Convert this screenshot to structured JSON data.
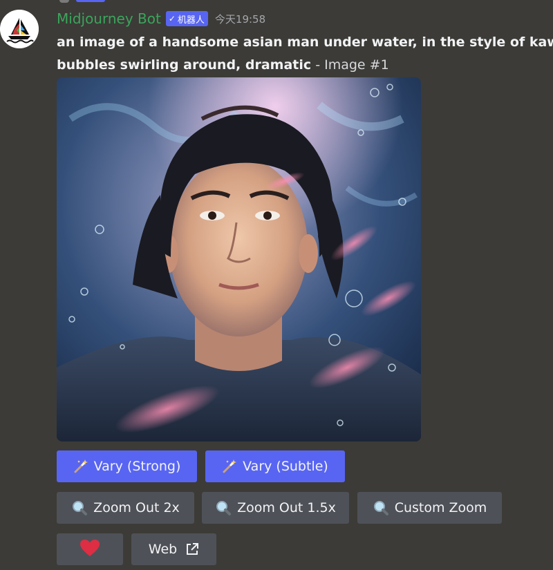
{
  "message": {
    "username": "Midjourney Bot",
    "bot_tag": "机器人",
    "bot_tag_check": "✓",
    "timestamp": "今天19:58",
    "prompt_line1": "an image of a handsome asian man under water, in the style of kawa",
    "prompt_line2_bold": "bubbles swirling around, dramatic",
    "prompt_suffix": " - Image #1"
  },
  "buttons": {
    "vary_strong": "Vary (Strong)",
    "vary_subtle": "Vary (Subtle)",
    "zoom_out_2x": "Zoom Out 2x",
    "zoom_out_15x": "Zoom Out 1.5x",
    "custom_zoom": "Custom Zoom",
    "web": "Web"
  },
  "colors": {
    "background": "#3c3b37",
    "username": "#3ba55c",
    "blurple": "#5865f2",
    "secondary_button": "#4f5158",
    "heart": "#dd2e44"
  },
  "icons": {
    "vary": "magic-wand-icon",
    "zoom": "magnifier-icon",
    "favorite": "heart-icon",
    "external": "external-link-icon",
    "avatar": "sailboat-logo"
  }
}
